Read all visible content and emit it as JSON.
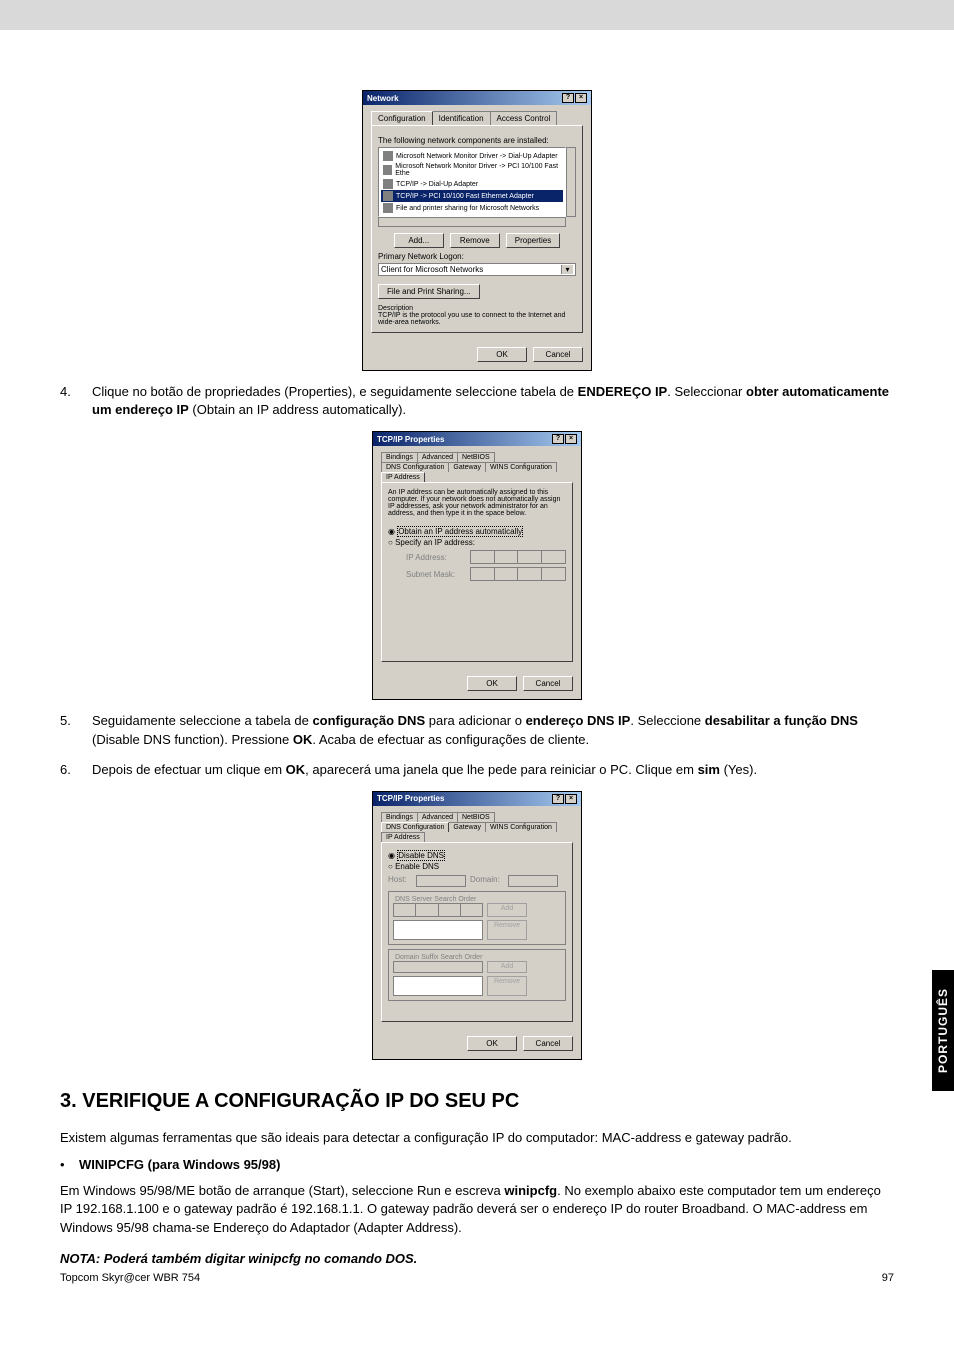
{
  "dialog1": {
    "title": "Network",
    "tabs": [
      "Configuration",
      "Identification",
      "Access Control"
    ],
    "intro": "The following network components are installed:",
    "items": [
      "Microsoft Network Monitor Driver -> Dial-Up Adapter",
      "Microsoft Network Monitor Driver -> PCI 10/100 Fast Ethe",
      "TCP/IP -> Dial-Up Adapter",
      "TCP/IP -> PCI 10/100 Fast Ethernet Adapter",
      "File and printer sharing for Microsoft Networks"
    ],
    "btn_add": "Add...",
    "btn_remove": "Remove",
    "btn_props": "Properties",
    "logon_label": "Primary Network Logon:",
    "logon_value": "Client for Microsoft Networks",
    "btn_share": "File and Print Sharing...",
    "desc_label": "Description",
    "desc_text": "TCP/IP is the protocol you use to connect to the Internet and wide-area networks.",
    "btn_ok": "OK",
    "btn_cancel": "Cancel"
  },
  "step4": {
    "num": "4.",
    "text_a": "Clique no botão de propriedades (Properties), e seguidamente seleccione tabela de ",
    "bold_a": "ENDEREÇO IP",
    "text_b": ". Seleccionar ",
    "bold_b": "obter automaticamente um endereço IP",
    "text_c": " (Obtain an IP address automatically)."
  },
  "dialog2": {
    "title": "TCP/IP Properties",
    "tabs1": [
      "Bindings",
      "Advanced",
      "NetBIOS"
    ],
    "tabs2": [
      "DNS Configuration",
      "Gateway",
      "WINS Configuration",
      "IP Address"
    ],
    "intro": "An IP address can be automatically assigned to this computer. If your network does not automatically assign IP addresses, ask your network administrator for an address, and then type it in the space below.",
    "radio1": "Obtain an IP address automatically",
    "radio2": "Specify an IP address:",
    "ip_label": "IP Address:",
    "mask_label": "Subnet Mask:",
    "btn_ok": "OK",
    "btn_cancel": "Cancel"
  },
  "step5": {
    "num": "5.",
    "text_a": "Seguidamente seleccione a tabela de ",
    "bold_a": "configuração DNS",
    "text_b": " para adicionar o ",
    "bold_b": "endereço DNS IP",
    "text_c": ". Seleccione ",
    "bold_c": "desabilitar a função DNS",
    "text_d": " (Disable DNS function). Pressione ",
    "bold_d": "OK",
    "text_e": ". Acaba de efectuar as configurações de cliente."
  },
  "step6": {
    "num": "6.",
    "text_a": "Depois de efectuar um clique em ",
    "bold_a": "OK",
    "text_b": ", aparecerá uma janela que lhe pede para reiniciar o PC. Clique em ",
    "bold_b": "sim",
    "text_c": " (Yes)."
  },
  "dialog3": {
    "title": "TCP/IP Properties",
    "tabs1": [
      "Bindings",
      "Advanced",
      "NetBIOS"
    ],
    "tabs2": [
      "DNS Configuration",
      "Gateway",
      "WINS Configuration",
      "IP Address"
    ],
    "radio1": "Disable DNS",
    "radio2": "Enable DNS",
    "host_label": "Host:",
    "domain_label": "Domain:",
    "search_label": "DNS Server Search Order",
    "suffix_label": "Domain Suffix Search Order",
    "btn_add": "Add",
    "btn_remove": "Remove",
    "btn_ok": "OK",
    "btn_cancel": "Cancel"
  },
  "heading": "3.  VERIFIQUE A CONFIGURAÇÃO IP DO SEU PC",
  "para1": "Existem algumas ferramentas que são ideais para detectar a configuração IP do computador: MAC-address e gateway padrão.",
  "bullet": "•",
  "bullet_text": "WINIPCFG (para Windows 95/98)",
  "para2_a": "Em Windows 95/98/ME botão de arranque (Start), seleccione Run e escreva ",
  "para2_bold": "winipcfg",
  "para2_b": ". No exemplo abaixo este computador tem um endereço IP 192.168.1.100 e o gateway padrão é 192.168.1.1. O gateway padrão deverá ser o endereço IP do router Broadband. O MAC-address em Windows 95/98 chama-se Endereço do Adaptador (Adapter Address).",
  "note": "NOTA: Poderá também digitar winipcfg no comando DOS.",
  "footer_left": "Topcom Skyr@cer WBR 754",
  "footer_right": "97",
  "side_tab": "PORTUGUÊS"
}
